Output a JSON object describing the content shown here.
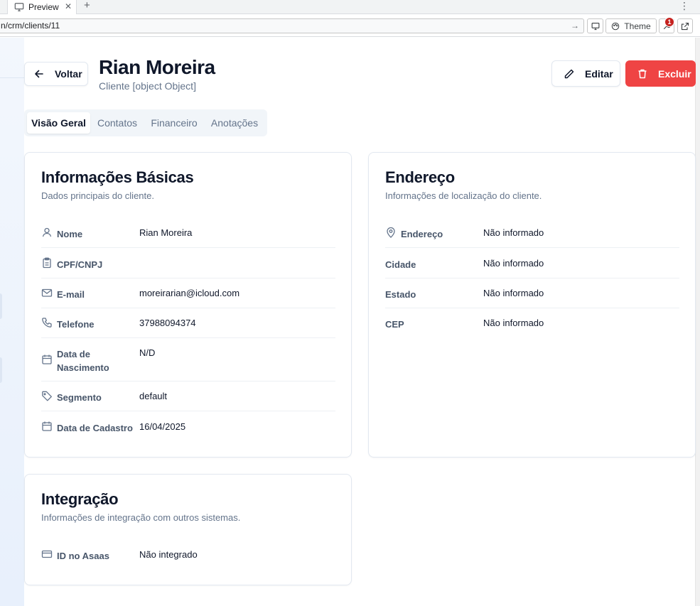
{
  "browser": {
    "tab_title": "Preview",
    "tab_close": "✕",
    "new_tab": "+",
    "url": "n/crm/clients/11",
    "theme_label": "Theme",
    "notif_count": "1"
  },
  "header": {
    "back_label": "Voltar",
    "client_name": "Rian Moreira",
    "client_sub": "Cliente [object Object]",
    "edit_label": "Editar",
    "delete_label": "Excluir"
  },
  "tabs": [
    "Visão Geral",
    "Contatos",
    "Financeiro",
    "Anotações"
  ],
  "basic_info": {
    "title": "Informações Básicas",
    "description": "Dados principais do cliente.",
    "rows": [
      {
        "label": "Nome",
        "value": "Rian Moreira",
        "icon": "user-icon"
      },
      {
        "label": "CPF/CNPJ",
        "value": "",
        "icon": "clipboard-icon"
      },
      {
        "label": "E-mail",
        "value": "moreirarian@icloud.com",
        "icon": "mail-icon"
      },
      {
        "label": "Telefone",
        "value": "37988094374",
        "icon": "phone-icon"
      },
      {
        "label": "Data de Nascimento",
        "label_line1": "Data de",
        "label_line2": "Nascimento",
        "value": "N/D",
        "icon": "calendar-icon"
      },
      {
        "label": "Segmento",
        "value": "default",
        "icon": "tag-icon"
      },
      {
        "label": "Data de Cadastro",
        "value": "16/04/2025",
        "icon": "calendar-icon"
      }
    ]
  },
  "address": {
    "title": "Endereço",
    "description": "Informações de localização do cliente.",
    "rows": [
      {
        "label": "Endereço",
        "value": "Não informado",
        "icon": "map-pin-icon"
      },
      {
        "label": "Cidade",
        "value": "Não informado"
      },
      {
        "label": "Estado",
        "value": "Não informado"
      },
      {
        "label": "CEP",
        "value": "Não informado"
      }
    ]
  },
  "integration": {
    "title": "Integração",
    "description": "Informações de integração com outros sistemas.",
    "rows": [
      {
        "label": "ID no Asaas",
        "value": "Não integrado",
        "icon": "credit-card-icon"
      }
    ]
  },
  "colors": {
    "danger": "#ef4444",
    "text": "#0f172a",
    "muted": "#64748b",
    "border": "#e2e8f0"
  }
}
